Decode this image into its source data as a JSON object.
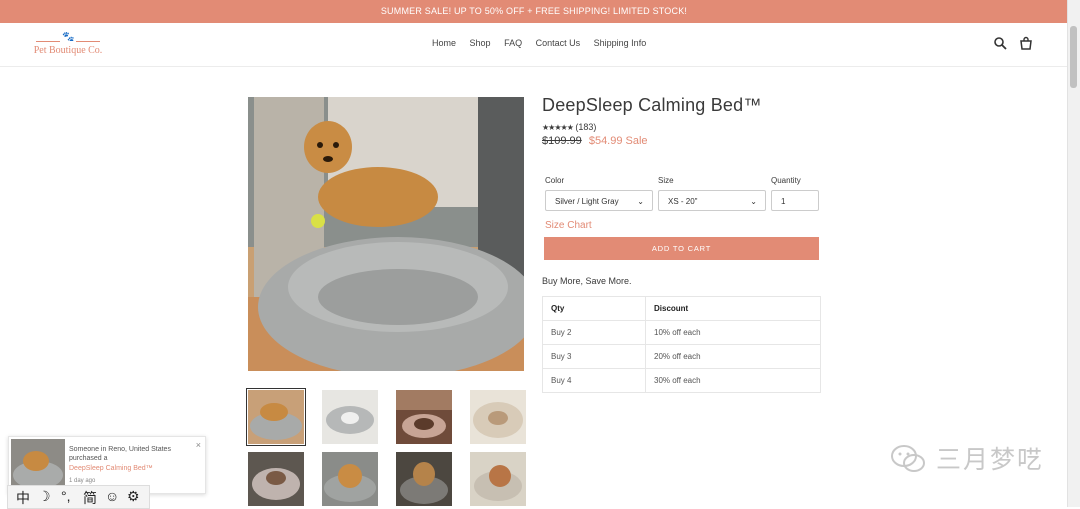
{
  "banner": {
    "text": "SUMMER SALE! UP TO 50% OFF + FREE SHIPPING! LIMITED STOCK!"
  },
  "logo": {
    "name": "Pet Boutique Co."
  },
  "nav": {
    "items": [
      "Home",
      "Shop",
      "FAQ",
      "Contact Us",
      "Shipping Info"
    ]
  },
  "header_icons": [
    "search-icon",
    "cart-icon"
  ],
  "product": {
    "title": "DeepSleep Calming Bed™",
    "rating_count": "(183)",
    "stars": "★★★★★",
    "compare_price": "$109.99",
    "sale_price": "$54.99 Sale",
    "color_label": "Color",
    "color_value": "Silver / Light Gray",
    "size_label": "Size",
    "size_value": "XS - 20\"",
    "qty_label": "Quantity",
    "qty_value": "1",
    "size_chart": "Size Chart",
    "add_to_cart": "ADD TO CART",
    "buy_more": "Buy More, Save More."
  },
  "discount_table": {
    "headers": [
      "Qty",
      "Discount"
    ],
    "rows": [
      [
        "Buy 2",
        "10% off each"
      ],
      [
        "Buy 3",
        "20% off each"
      ],
      [
        "Buy 4",
        "30% off each"
      ]
    ]
  },
  "popup": {
    "line1": "Someone in Reno, United States purchased a",
    "product": "DeepSleep Calming Bed™",
    "time": "1 day ago",
    "close": "×"
  },
  "ime": {
    "items": [
      "中",
      "☽",
      "°,",
      "简",
      "☺",
      "⚙"
    ]
  },
  "watermark": {
    "text": "三月梦呓"
  },
  "colors": {
    "accent": "#e28b75",
    "text": "#3a3a3a"
  }
}
